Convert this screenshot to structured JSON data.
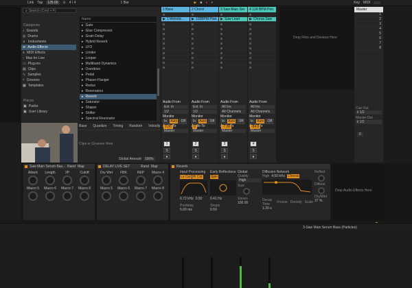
{
  "topbar": {
    "link": "Link",
    "tap": "Tap",
    "tempo": "125.00",
    "time_sig": "4 / 4",
    "loop": "1 Bar",
    "key": "Key",
    "midi": "MIDI"
  },
  "browser": {
    "search_placeholder": "Search (Cmd + F)",
    "categories_header": "Categories",
    "categories": [
      "Sounds",
      "Drums",
      "Instruments",
      "Audio Effects",
      "MIDI Effects",
      "Max for Live",
      "Plug-ins",
      "Clips",
      "Samples",
      "Grooves",
      "Templates"
    ],
    "places_header": "Places",
    "places": [
      "Packs",
      "User Library"
    ],
    "name_header": "Name",
    "items": [
      "Gate",
      "Glue Compressor",
      "Grain Delay",
      "Hybrid Reverb",
      "LFO",
      "Limiter",
      "Looper",
      "Multiband Dynamics",
      "Overdrive",
      "Pedal",
      "Phaser-Flanger",
      "Redux",
      "Resonators",
      "Reverb",
      "Saturator",
      "Shaper",
      "Shifter",
      "Spectral Resonator"
    ],
    "selected_item": "Reverb"
  },
  "groove": {
    "headers": [
      "Base",
      "Quantize",
      "Timing",
      "Random",
      "Velocity"
    ],
    "drop_text": "Clips or Grooves Here",
    "global_label": "Global Amount",
    "global_value": "100%"
  },
  "tracks": [
    {
      "name": "1 Bass",
      "clip": "1 Melodic...",
      "color": "#5bb4e0",
      "io_from": "Ext. In",
      "ch": "1/2",
      "monitor": [
        "In",
        "Auto",
        "Off"
      ],
      "to": "Master",
      "vol": "0.00",
      "meter": 0.0
    },
    {
      "name": "2 Chord",
      "clip": "128BPM Pian...",
      "color": "#5bb4e0",
      "io_from": "Ext. In",
      "ch": "1/2",
      "monitor": [
        "In",
        "Auto",
        "Off"
      ],
      "to": "Master",
      "vol": "0",
      "meter": 0.0
    },
    {
      "name": "3 Saw Main Ser",
      "clip": "Saw Lead",
      "color": "#49c7b9",
      "io_from": "All Ins",
      "ch": "All Channels",
      "monitor": [
        "In",
        "Auto",
        "Off"
      ],
      "to": "Master",
      "vol": "-7.80",
      "meter": 0.72
    },
    {
      "name": "4 124 BPM Pno",
      "clip": "Chorus Saw",
      "color": "#49c7b9",
      "io_from": "All Ins",
      "ch": "All Channels",
      "monitor": [
        "In",
        "Auto",
        "Off"
      ],
      "to": "Master",
      "vol": "-84.0",
      "meter": 0.15
    }
  ],
  "drop_files": "Drop Files and Devices Here",
  "master": {
    "name": "Master",
    "scene_numbers": [
      "1",
      "2",
      "3",
      "4",
      "5",
      "6",
      "7",
      "8"
    ],
    "cue_out_label": "Cue Out",
    "cue_out_value": "ii 1/2",
    "master_out_label": "Master Out",
    "master_out_value": "ii 1/2",
    "vol": "0"
  },
  "io_labels": {
    "audio_from": "Audio From",
    "monitor": "Monitor",
    "audio_to": "Audio To"
  },
  "rack1": {
    "title": "Saw Main Serum Bas...",
    "menu": [
      "Rand",
      "Map"
    ],
    "macros": [
      "Attack",
      "Length",
      "2P",
      "Cutoff",
      "Macro 5",
      "Macro 6",
      "Macro 7",
      "Macro 8"
    ]
  },
  "rack2": {
    "title": "DELAY LIVE SET",
    "menu": [
      "Rand",
      "Map"
    ],
    "macros": [
      "Dry Wet",
      "FBK",
      "REP",
      "Macro 4",
      "Macro 5",
      "Macro 6",
      "Macro 7",
      "Macro 8"
    ]
  },
  "reverb": {
    "title": "Reverb",
    "input_section": "Input Processing",
    "lo_cut": "Lo Cut",
    "hi_cut": "Hi Cut",
    "spin": "Spin",
    "freq": "6.72 kHz",
    "freq2": "0.50",
    "predelay_label": "Predelay",
    "predelay": "5.00 ms",
    "early_section": "Early Reflections",
    "spin_value": "0.41 Hz",
    "shape_label": "Shape",
    "shape": "0.50",
    "global_section": "Global",
    "quality_label": "Quality",
    "quality": "High",
    "size_label": "Size",
    "stereo_label": "Stereo",
    "stereo": "100.00",
    "diffusion_section": "Diffusion Network",
    "high_label": "High",
    "high_freq": "4.50 kHz",
    "decay_label": "Decay Time",
    "decay": "1.20 s",
    "freeze_label": "Freeze",
    "density_label": "Density",
    "scale_label": "Scale",
    "reflect_label": "Reflect",
    "diffuse_label": "Diffuse",
    "drywet_label": "Dry/Wet",
    "drywet": "37 %",
    "chorus_label": "Chorus"
  },
  "drop_audio": "Drop Audio Effects Here",
  "status": "3-Saw Main Serum Bass (Particles)"
}
